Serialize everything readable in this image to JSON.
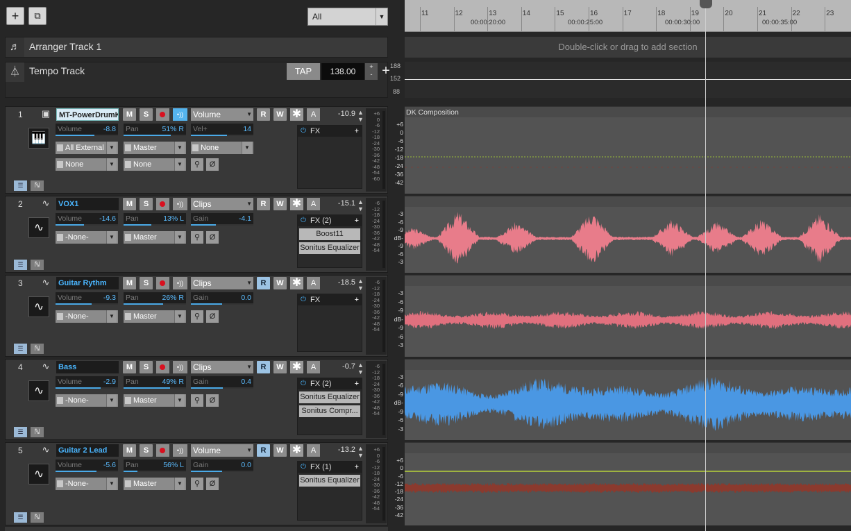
{
  "toolbar": {
    "add_icon": "plus-icon",
    "duplicate_icon": "duplicate-icon",
    "filter": "All"
  },
  "ruler": {
    "bars": [
      "11",
      "12",
      "13",
      "14",
      "15",
      "16",
      "17",
      "18",
      "19",
      "20",
      "21",
      "22",
      "23"
    ],
    "timecodes": [
      "00:00:20:00",
      "00:00:25:00",
      "00:00:30:00",
      "00:00:35:00"
    ]
  },
  "arranger": {
    "name": "Arranger Track 1",
    "hint": "Double-click or drag to add section"
  },
  "tempo": {
    "name": "Tempo Track",
    "tap": "TAP",
    "bpm": "138.00",
    "scale": [
      "188",
      "152",
      "88"
    ]
  },
  "clip1_name": "DK Composition",
  "tracks": [
    {
      "num": "1",
      "name": "MT-PowerDrumK",
      "type": "instrument",
      "selected": true,
      "automation": "Volume",
      "vol_total": "-10.9",
      "volume": "-8.8",
      "pan": "51% R",
      "third_label": "Vel+",
      "third": "14",
      "input": "All External",
      "output": "Master",
      "ch": "None",
      "ch2_a": "None",
      "ch2_b": "None",
      "fx_title": "FX",
      "fx": [],
      "read_on": false,
      "mon_on": true,
      "vol_fill": 0.62,
      "pan_fill": 0.76,
      "third_fill": 0.58,
      "scale": [
        "+6",
        "0",
        "-6",
        "-12",
        "-18",
        "-24",
        "-30",
        "-36",
        "-42",
        "-48",
        "-54",
        "-60"
      ]
    },
    {
      "num": "2",
      "name": "VOX1",
      "type": "audio",
      "selected": false,
      "automation": "Clips",
      "vol_total": "-15.1",
      "volume": "-14.6",
      "pan": "13% L",
      "third_label": "Gain",
      "third": "-4.1",
      "input": "-None-",
      "output": "Master",
      "fx_title": "FX (2)",
      "fx": [
        "Boost11",
        "Sonitus Equalizer"
      ],
      "read_on": false,
      "mon_on": false,
      "vol_fill": 0.45,
      "pan_fill": 0.44,
      "third_fill": 0.4,
      "scale": [
        "-6",
        "-12",
        "-18",
        "-24",
        "-30",
        "-36",
        "-42",
        "-48",
        "-54"
      ]
    },
    {
      "num": "3",
      "name": "Guitar Rythm",
      "type": "audio",
      "selected": false,
      "automation": "Clips",
      "vol_total": "-18.5",
      "volume": "-9.3",
      "pan": "26% R",
      "third_label": "Gain",
      "third": "0.0",
      "input": "-None-",
      "output": "Master",
      "fx_title": "FX",
      "fx": [],
      "read_on": true,
      "mon_on": false,
      "vol_fill": 0.58,
      "pan_fill": 0.63,
      "third_fill": 0.5,
      "scale": [
        "-6",
        "-12",
        "-18",
        "-24",
        "-30",
        "-36",
        "-42",
        "-48",
        "-54"
      ]
    },
    {
      "num": "4",
      "name": "Bass",
      "type": "audio",
      "selected": false,
      "automation": "Clips",
      "vol_total": "-0.7",
      "volume": "-2.9",
      "pan": "49% R",
      "third_label": "Gain",
      "third": "0.4",
      "input": "-None-",
      "output": "Master",
      "fx_title": "FX (2)",
      "fx": [
        "Sonitus Equalizer",
        "Sonitus Compr..."
      ],
      "read_on": true,
      "mon_on": false,
      "vol_fill": 0.72,
      "pan_fill": 0.74,
      "third_fill": 0.51,
      "scale": [
        "-6",
        "-12",
        "-18",
        "-24",
        "-30",
        "-36",
        "-42",
        "-48",
        "-54"
      ]
    },
    {
      "num": "5",
      "name": "Guitar 2 Lead",
      "type": "audio",
      "selected": false,
      "automation": "Volume",
      "vol_total": "-13.2",
      "volume": "-5.6",
      "pan": "56% L",
      "third_label": "Gain",
      "third": "0.0",
      "input": "-None-",
      "output": "Master",
      "fx_title": "FX (1)",
      "fx": [
        "Sonitus Equalizer"
      ],
      "read_on": true,
      "mon_on": false,
      "vol_fill": 0.66,
      "pan_fill": 0.22,
      "third_fill": 0.5,
      "scale": [
        "+6",
        "0",
        "-6",
        "-12",
        "-18",
        "-24",
        "-30",
        "-36",
        "-42",
        "-48",
        "-54"
      ]
    }
  ],
  "clip_scales": {
    "drum": [
      "+6",
      "0",
      "-6",
      "-12",
      "-18",
      "-24",
      "-36",
      "-42"
    ],
    "audio": [
      "-3",
      "-6",
      "-9",
      "dB-",
      "-9",
      "-6",
      "-3"
    ],
    "lead": [
      "+6",
      "0",
      "-6",
      "-12",
      "-18",
      "-24",
      "-36",
      "-42"
    ]
  },
  "colors": {
    "vox": "#e87c8a",
    "guitar": "#e0707e",
    "bass": "#4a97e3",
    "lead": "#8b3a2e",
    "accent": "#4ab6ff"
  }
}
